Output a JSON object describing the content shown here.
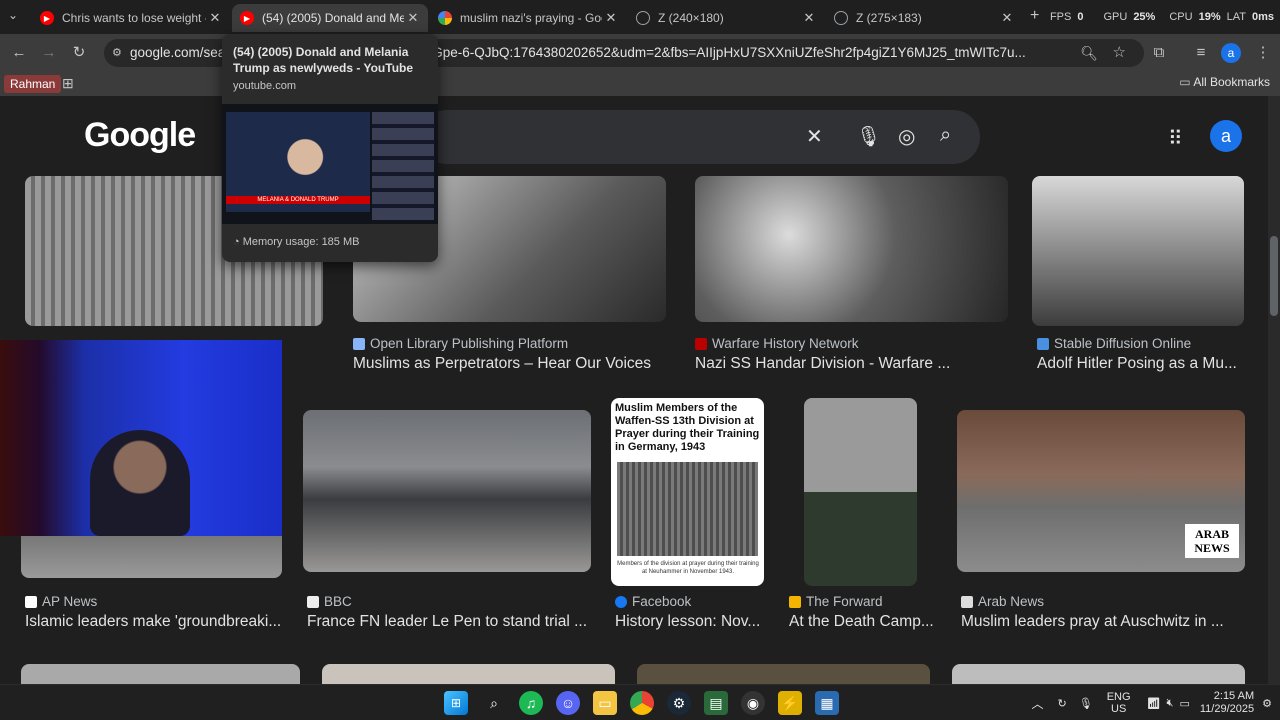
{
  "tabs": [
    {
      "title": "Chris wants to lose weight - You",
      "favicon": "youtube-icon",
      "active": false
    },
    {
      "title": "(54) (2005) Donald and Melania",
      "favicon": "youtube-icon",
      "active": true
    },
    {
      "title": "muslim nazi's praying - Google",
      "favicon": "google-icon",
      "active": false
    },
    {
      "title": "Z (240×180)",
      "favicon": "globe-icon",
      "active": false
    },
    {
      "title": "Z (275×183)",
      "favicon": "globe-icon",
      "active": false
    }
  ],
  "overlay": {
    "fps_label": "FPS",
    "fps": "0",
    "gpu_label": "GPU",
    "gpu": "25%",
    "cpu_label": "CPU",
    "cpu": "19%",
    "lat_label": "LAT",
    "lat": "0ms"
  },
  "url": "google.com/search?q=...TifN4BA1ZCj5rR-yHUedTGpe-6-QJbQ:1764380202652&udm=2&fbs=AIIjpHxU7SXXniUZfeShr2fp4giZ1Y6MJ25_tmWITc7u...",
  "bookmarks": {
    "profile": "Rahman",
    "all": "All Bookmarks"
  },
  "google": {
    "logo": "Google",
    "account_initial": "a"
  },
  "tooltip": {
    "title": "(54) (2005) Donald and Melania Trump as newlyweds - YouTube",
    "domain": "youtube.com",
    "memory": "Memory usage: 185 MB",
    "preview_banner": "MELANIA & DONALD TRUMP"
  },
  "results_row1": [
    {
      "source": "",
      "caption": ""
    },
    {
      "source": "Open Library Publishing Platform",
      "caption": "Muslims as Perpetrators – Hear Our Voices"
    },
    {
      "source": "Warfare History Network",
      "caption": "Nazi SS Handar Division - Warfare ..."
    },
    {
      "source": "Stable Diffusion Online",
      "caption": "Adolf Hitler Posing as a Mu..."
    }
  ],
  "results_row2": [
    {
      "source": "AP News",
      "caption": "Islamic leaders make 'groundbreaki..."
    },
    {
      "source": "BBC",
      "caption": "France FN leader Le Pen to stand trial ..."
    },
    {
      "source": "Facebook",
      "caption": "History lesson: Nov..."
    },
    {
      "source": "The Forward",
      "caption": "At the Death Camp..."
    },
    {
      "source": "Arab News",
      "caption": "Muslim leaders pray at Auschwitz in ..."
    }
  ],
  "facebook_card": {
    "headline": "Muslim Members of the Waffen-SS 13th Division at Prayer during their Training in Germany, 1943",
    "footnote": "Members of the division at prayer during their training at Neuhammer in November 1943."
  },
  "arab_news_watermark": "ARAB NEWS",
  "taskbar": {
    "lang1": "ENG",
    "lang2": "US",
    "time": "2:15 AM",
    "date": "11/29/2025"
  },
  "colors": {
    "accent": "#1a73e8",
    "youtube": "#ff0000"
  }
}
